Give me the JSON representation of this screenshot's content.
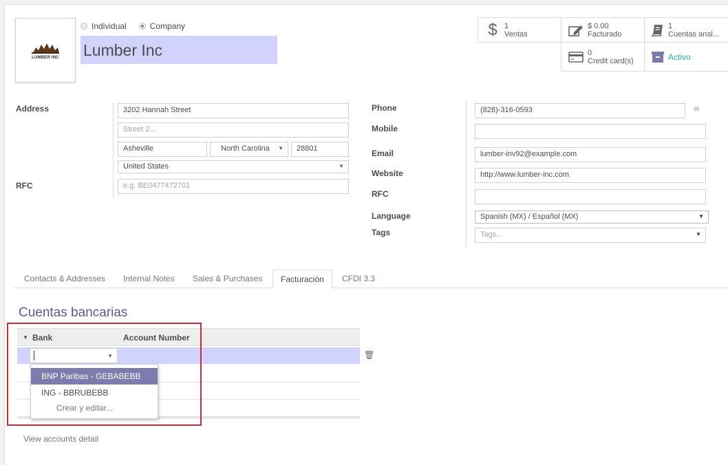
{
  "header": {
    "logo_text": "LUMBER INC",
    "radio_individual": "Individual",
    "radio_company": "Company",
    "company_name": "Lumber Inc"
  },
  "stats": {
    "ventas_count": "1",
    "ventas_label": "Ventas",
    "facturado_amount": "$ 0.00",
    "facturado_label": "Facturado",
    "cuentas_count": "1",
    "cuentas_label": "Cuentas anal...",
    "credit_count": "0",
    "credit_label": "Credit card(s)",
    "activo_label": "Activo"
  },
  "address": {
    "label": "Address",
    "street": "3202  Hannah Street",
    "street2_placeholder": "Street 2...",
    "city": "Asheville",
    "state": "North Carolina",
    "zip": "28801",
    "country": "United States",
    "rfc_label": "RFC",
    "rfc_placeholder": "e.g. BE0477472701"
  },
  "contact": {
    "phone_label": "Phone",
    "phone_value": "(828)-316-0593",
    "mobile_label": "Mobile",
    "mobile_value": "",
    "email_label": "Email",
    "email_value": "lumber-inv92@example.com",
    "website_label": "Website",
    "website_value": "http://www.lumber-inc.com",
    "rfc_label": "RFC",
    "rfc_value": "",
    "language_label": "Language",
    "language_value": "Spanish (MX) / Español (MX)",
    "tags_label": "Tags",
    "tags_placeholder": "Tags..."
  },
  "tabs": [
    "Contacts & Addresses",
    "Internal Notes",
    "Sales & Purchases",
    "Facturación",
    "CFDI 3.3"
  ],
  "active_tab": "Facturación",
  "bank_section": {
    "title": "Cuentas bancarias",
    "col_bank": "Bank",
    "col_account": "Account Number",
    "dropdown_items": [
      "BNP Paribas - GEBABEBB",
      "ING - BBRUBEBB"
    ],
    "create_edit": "Crear y editar...",
    "view_link": "View accounts detail"
  },
  "colors": {
    "accent": "#7c7bad",
    "highlight": "#d2d2ff",
    "title": "#5b5a8e",
    "active_green": "#21b799",
    "red_box": "#cc2a36"
  }
}
